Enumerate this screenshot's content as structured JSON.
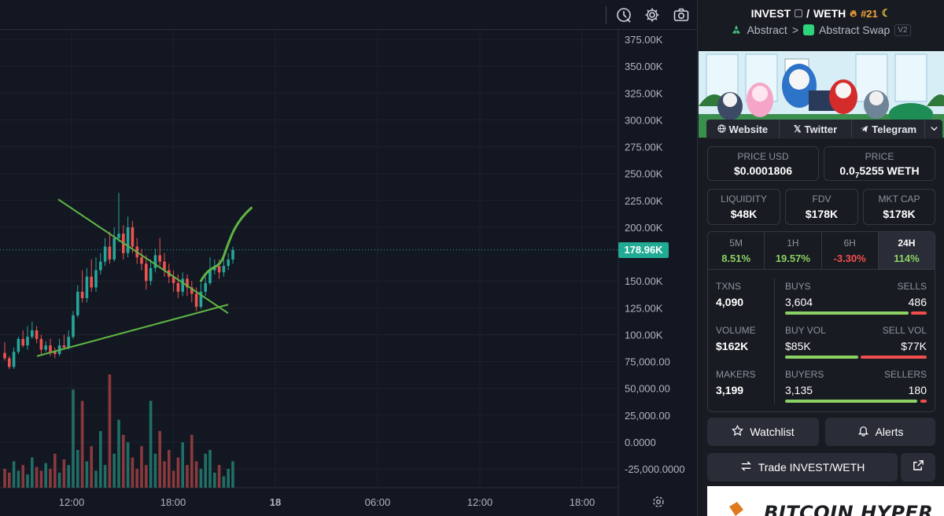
{
  "toolbar": {
    "icons": [
      "replay-clock-icon",
      "gear-icon",
      "camera-icon"
    ]
  },
  "chart_data": {
    "type": "candlestick",
    "y_ticks": [
      "375.00K",
      "350.00K",
      "325.00K",
      "300.00K",
      "275.00K",
      "250.00K",
      "225.00K",
      "200.00K",
      "150.00K",
      "125.00K",
      "100.00K",
      "75,000.00",
      "50,000.00",
      "25,000.00",
      "0.0000",
      "-25,000.0000"
    ],
    "ylim": [
      -30000,
      390000
    ],
    "x_ticks": [
      "12:00",
      "18:00",
      "18",
      "06:00",
      "12:00",
      "18:00"
    ],
    "last_price_label": "178.96K",
    "up_color": "#26a69a",
    "down_color": "#ef5350",
    "candles": [
      [
        83,
        78,
        93,
        76
      ],
      [
        78,
        70,
        80,
        68
      ],
      [
        70,
        84,
        88,
        68
      ],
      [
        84,
        96,
        98,
        82
      ],
      [
        96,
        90,
        104,
        88
      ],
      [
        90,
        98,
        108,
        86
      ],
      [
        98,
        104,
        112,
        96
      ],
      [
        104,
        96,
        108,
        92
      ],
      [
        96,
        86,
        100,
        82
      ],
      [
        86,
        90,
        94,
        84
      ],
      [
        90,
        84,
        96,
        80
      ],
      [
        84,
        82,
        88,
        78
      ],
      [
        82,
        90,
        96,
        80
      ],
      [
        90,
        88,
        100,
        86
      ],
      [
        88,
        98,
        104,
        86
      ],
      [
        98,
        118,
        122,
        96
      ],
      [
        118,
        140,
        146,
        116
      ],
      [
        140,
        134,
        160,
        130
      ],
      [
        134,
        154,
        162,
        130
      ],
      [
        154,
        144,
        170,
        140
      ],
      [
        144,
        160,
        172,
        140
      ],
      [
        160,
        168,
        176,
        156
      ],
      [
        168,
        182,
        190,
        164
      ],
      [
        182,
        170,
        196,
        166
      ],
      [
        170,
        190,
        200,
        168
      ],
      [
        190,
        194,
        232,
        186
      ],
      [
        194,
        176,
        202,
        170
      ],
      [
        176,
        200,
        210,
        172
      ],
      [
        200,
        182,
        206,
        176
      ],
      [
        182,
        172,
        190,
        166
      ],
      [
        172,
        166,
        180,
        160
      ],
      [
        166,
        150,
        174,
        142
      ],
      [
        150,
        162,
        170,
        146
      ],
      [
        162,
        174,
        180,
        158
      ],
      [
        174,
        168,
        190,
        164
      ],
      [
        168,
        160,
        176,
        154
      ],
      [
        160,
        154,
        166,
        148
      ],
      [
        154,
        148,
        160,
        140
      ],
      [
        148,
        140,
        156,
        134
      ],
      [
        140,
        152,
        158,
        136
      ],
      [
        152,
        144,
        156,
        136
      ],
      [
        144,
        138,
        150,
        130
      ],
      [
        138,
        126,
        144,
        122
      ],
      [
        126,
        140,
        148,
        124
      ],
      [
        140,
        148,
        154,
        136
      ],
      [
        148,
        160,
        172,
        146
      ],
      [
        160,
        164,
        170,
        156
      ],
      [
        164,
        158,
        170,
        152
      ],
      [
        158,
        164,
        172,
        154
      ],
      [
        164,
        170,
        176,
        160
      ],
      [
        170,
        178.96,
        182,
        166
      ]
    ],
    "volume": [
      10,
      8,
      14,
      9,
      12,
      7,
      16,
      11,
      9,
      13,
      10,
      18,
      8,
      15,
      12,
      52,
      20,
      46,
      14,
      22,
      9,
      30,
      12,
      60,
      18,
      36,
      28,
      24,
      16,
      10,
      22,
      12,
      46,
      18,
      30,
      14,
      20,
      9,
      16,
      24,
      12,
      28,
      14,
      10,
      18,
      20,
      8,
      12,
      6,
      10,
      14
    ],
    "drawings": {
      "upper_trendline": [
        [
          0,
          226
        ],
        [
          15,
          120
        ]
      ],
      "lower_trendline": [
        [
          -4,
          80
        ],
        [
          15,
          128
        ]
      ],
      "projection": "curve"
    }
  },
  "pair": {
    "base": "INVEST",
    "separator": "/",
    "quote": "WETH",
    "rank": "#21",
    "chain": "Abstract",
    "chevron": ">",
    "dex": "Abstract Swap",
    "version": "V2"
  },
  "links": {
    "website": "Website",
    "twitter": "Twitter",
    "telegram": "Telegram"
  },
  "price": {
    "usd_label": "PRICE USD",
    "usd_value": "$0.0001806",
    "native_label": "PRICE",
    "native_prefix": "0.0",
    "native_sub": "7",
    "native_rest": "5255 WETH"
  },
  "metrics": {
    "liquidity_label": "LIQUIDITY",
    "liquidity_value": "$48K",
    "fdv_label": "FDV",
    "fdv_value": "$178K",
    "mcap_label": "MKT CAP",
    "mcap_value": "$178K"
  },
  "timeframes": [
    {
      "name": "5M",
      "pct": "8.51%",
      "dir": "up"
    },
    {
      "name": "1H",
      "pct": "19.57%",
      "dir": "up"
    },
    {
      "name": "6H",
      "pct": "-3.30%",
      "dir": "down"
    },
    {
      "name": "24H",
      "pct": "114%",
      "dir": "up"
    }
  ],
  "txns": {
    "txns_label": "TXNS",
    "txns_value": "4,090",
    "buys_label": "BUYS",
    "buys_value": "3,604",
    "sells_label": "SELLS",
    "sells_value": "486",
    "buys_fraction": 0.881,
    "volume_label": "VOLUME",
    "volume_value": "$162K",
    "buyvol_label": "BUY VOL",
    "buyvol_value": "$85K",
    "sellvol_label": "SELL VOL",
    "sellvol_value": "$77K",
    "buyvol_fraction": 0.525,
    "makers_label": "MAKERS",
    "makers_value": "3,199",
    "buyers_label": "BUYERS",
    "buyers_value": "3,135",
    "sellers_label": "SELLERS",
    "sellers_value": "180",
    "buyers_fraction": 0.946
  },
  "actions": {
    "watchlist": "Watchlist",
    "alerts": "Alerts",
    "trade": "Trade INVEST/WETH"
  },
  "ad": {
    "text": "BITCOIN HYPER"
  }
}
